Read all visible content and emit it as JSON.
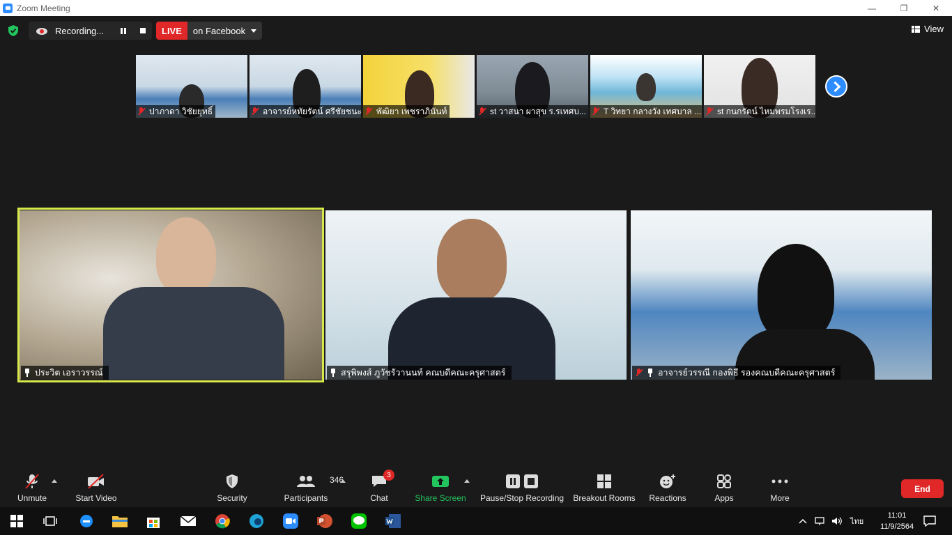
{
  "window": {
    "title": "Zoom Meeting",
    "min_glyph": "—",
    "max_glyph": "❐",
    "close_glyph": "✕"
  },
  "topbar": {
    "recording_label": "Recording...",
    "live_label": "LIVE",
    "live_target": "on Facebook",
    "view_label": "View"
  },
  "thumbnails": [
    {
      "name": "ปาภาดา วิชัยยุทธิ์"
    },
    {
      "name": "อาจารย์หทัยรัตน์ ศรีชัยชนะ"
    },
    {
      "name": "พัฒิยา เพชราภินันท์"
    },
    {
      "name": "st วาสนา ผาสุข ร.รเทศบ..."
    },
    {
      "name": "T วิทยา กลางวัง เทศบาล ..."
    },
    {
      "name": "st กนกรัตน์ ไหมพรมโรงเร..."
    }
  ],
  "tiles": [
    {
      "name": "ประวิต เอราวรรณ์"
    },
    {
      "name": "สรุพิพงส์ ภูวัชรัวานนท์ คณบดีคณะครุศาสตร์"
    },
    {
      "name": "อาจารย์วรรณี  กองพิธี รองคณบดีคณะครุศาสตร์"
    }
  ],
  "toolbar": {
    "unmute": "Unmute",
    "start_video": "Start Video",
    "security": "Security",
    "participants": "Participants",
    "participants_count": "346",
    "chat": "Chat",
    "chat_badge": "3",
    "share_screen": "Share Screen",
    "pause_stop_recording": "Pause/Stop Recording",
    "breakout_rooms": "Breakout Rooms",
    "reactions": "Reactions",
    "apps": "Apps",
    "more": "More",
    "end": "End"
  },
  "taskbar": {
    "language": "ไทย",
    "time": "11:01",
    "date": "11/9/2564"
  },
  "colors": {
    "accent_blue": "#2d8cff",
    "live_red": "#e02828",
    "share_green": "#22c55e",
    "active_speaker": "#d7e84a"
  }
}
